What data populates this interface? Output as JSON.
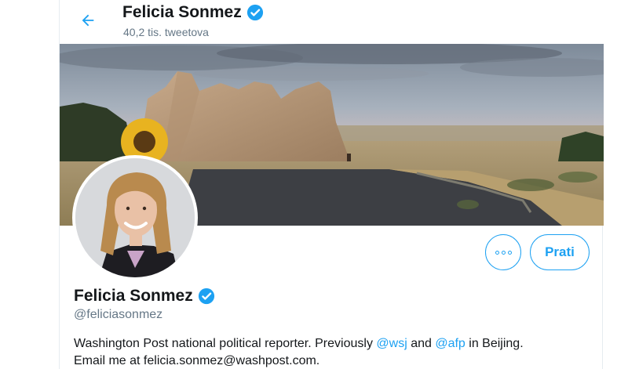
{
  "header": {
    "display_name": "Felicia Sonmez",
    "tweet_count": "40,2 tis. tweetova",
    "back_icon": "arrow-left-icon",
    "verified_icon": "verified-badge-icon"
  },
  "profile": {
    "display_name": "Felicia Sonmez",
    "handle": "@feliciasonmez",
    "bio": {
      "part1": "Washington Post national political reporter. Previously ",
      "mention1": "@wsj",
      "part2": " and ",
      "mention2": "@afp",
      "part3": " in Beijing.",
      "line2": "Email me at felicia.sonmez@washpost.com."
    }
  },
  "actions": {
    "more_icon": "more-options-icon",
    "follow_label": "Prati"
  },
  "colors": {
    "accent": "#1da1f2",
    "text_primary": "#14171a",
    "text_secondary": "#657786",
    "border": "#e6ecf0"
  }
}
